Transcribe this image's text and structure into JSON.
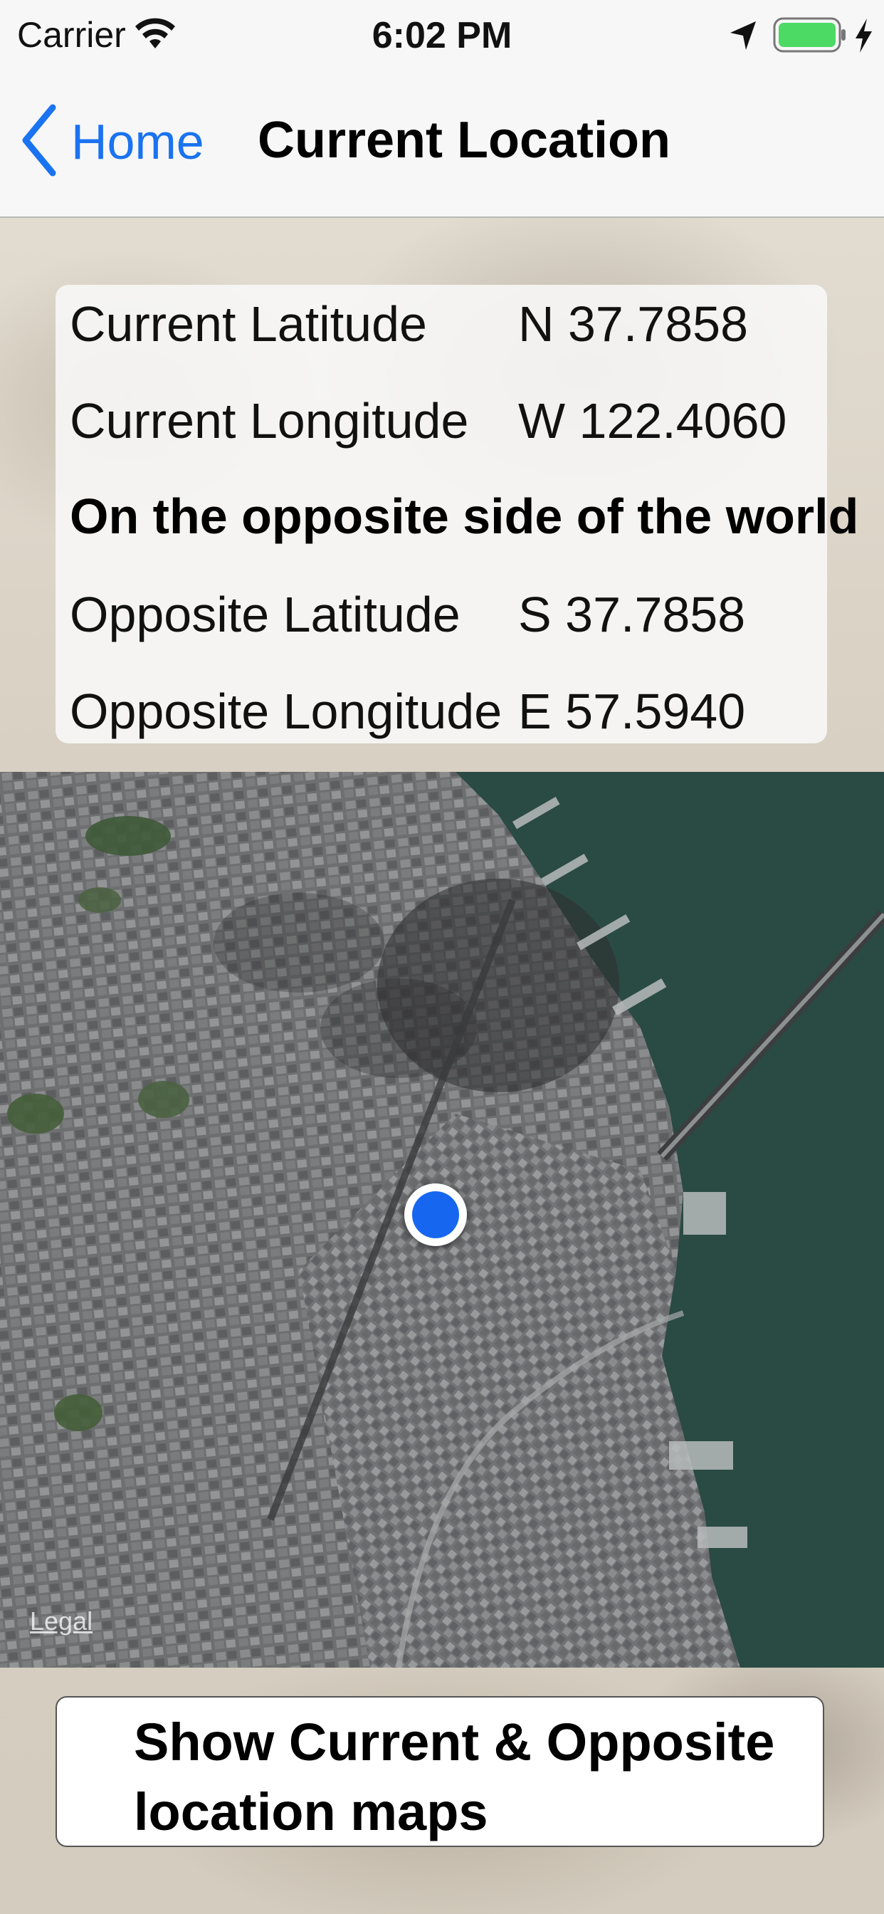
{
  "status_bar": {
    "carrier": "Carrier",
    "time": "6:02 PM",
    "icons": [
      "wifi-icon",
      "location-arrow-icon",
      "battery-icon",
      "charging-icon"
    ],
    "battery_color": "#4cd964"
  },
  "nav": {
    "back_label": "Home",
    "title": "Current Location",
    "accent_color": "#1a73f0"
  },
  "info": {
    "current_latitude_label": "Current Latitude",
    "current_latitude_value": "N 37.7858",
    "current_longitude_label": "Current Longitude",
    "current_longitude_value": "W 122.4060",
    "opposite_heading": "On the opposite side of the world",
    "opposite_latitude_label": "Opposite Latitude",
    "opposite_latitude_value": "S 37.7858",
    "opposite_longitude_label": "Opposite Longitude",
    "opposite_longitude_value": "E 57.5940"
  },
  "map": {
    "legal_label": "Legal",
    "user_dot_color": "#1666f0",
    "water_color": "#2a4a44"
  },
  "actions": {
    "show_maps_label": "Show Current & Opposite location maps"
  }
}
